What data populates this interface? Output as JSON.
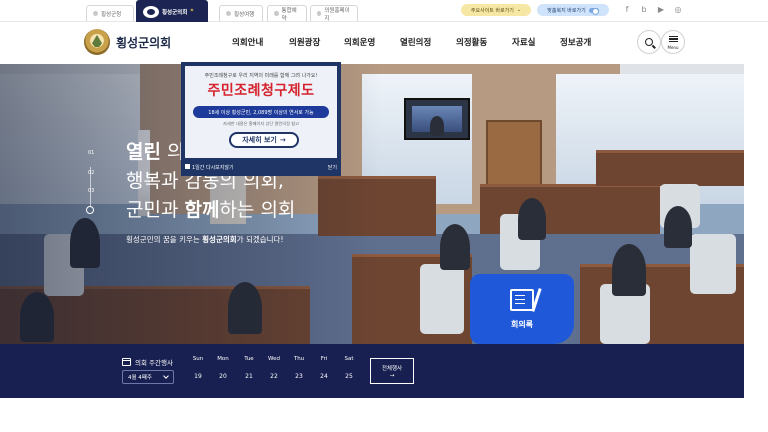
{
  "site_tabs": [
    {
      "label": "횡성군청",
      "active": false
    },
    {
      "label": "횡성군의회",
      "active": true
    },
    {
      "label": "횡성여행",
      "active": false
    },
    {
      "label": "통합예약",
      "active": false
    },
    {
      "label": "의원홈페이지",
      "active": false
    }
  ],
  "utility": {
    "shortcut_label": "주요사이트 바로가기",
    "welfare_label": "맞춤복지 바로가기",
    "social": [
      "f",
      "b",
      "▶",
      "◎"
    ]
  },
  "header": {
    "logo_text": "횡성군의회",
    "menu": [
      "의회안내",
      "의원광장",
      "의회운영",
      "열린의정",
      "의정활동",
      "자료실",
      "정보공개"
    ],
    "menu_button_label": "Menu"
  },
  "hero": {
    "slide_indicators": [
      "01",
      "02",
      "03"
    ],
    "headline_1_bold": "열린",
    "headline_1_rest": " 의",
    "headline_2": "행복과 감동의 의회,",
    "headline_3_pre": "군민과 ",
    "headline_3_bold": "함께",
    "headline_3_post": "하는 의회",
    "subline_pre": "횡성군민의 꿈을 키우는 ",
    "subline_bold": "횡성군의회",
    "subline_post": "가 되겠습니다!",
    "minutes_label": "회의록"
  },
  "popup": {
    "top_text": "주민조례청구로 우리 지역의 미래를 함께 그려 나가요!",
    "main_text": "주민조례청구제도",
    "band_text": "18세 이상 횡성군민, 2,089명 이상의 연서로 가능",
    "small_text": "자세한 내용은 홈페이지 상단 열린의정 참고",
    "cta_label": "자세히 보기",
    "cta_arrow": "→",
    "dismiss_label": "1일간 다시보지않기",
    "close_label": "닫기"
  },
  "schedule": {
    "title": "의회 주간행사",
    "week_label": "4월 4째주",
    "days": [
      {
        "name": "Sun",
        "date": "19"
      },
      {
        "name": "Mon",
        "date": "20"
      },
      {
        "name": "Tue",
        "date": "21"
      },
      {
        "name": "Wed",
        "date": "22"
      },
      {
        "name": "Thu",
        "date": "23"
      },
      {
        "name": "Fri",
        "date": "24"
      },
      {
        "name": "Sat",
        "date": "25"
      }
    ],
    "all_label": "전체행사",
    "all_arrow": "→"
  }
}
